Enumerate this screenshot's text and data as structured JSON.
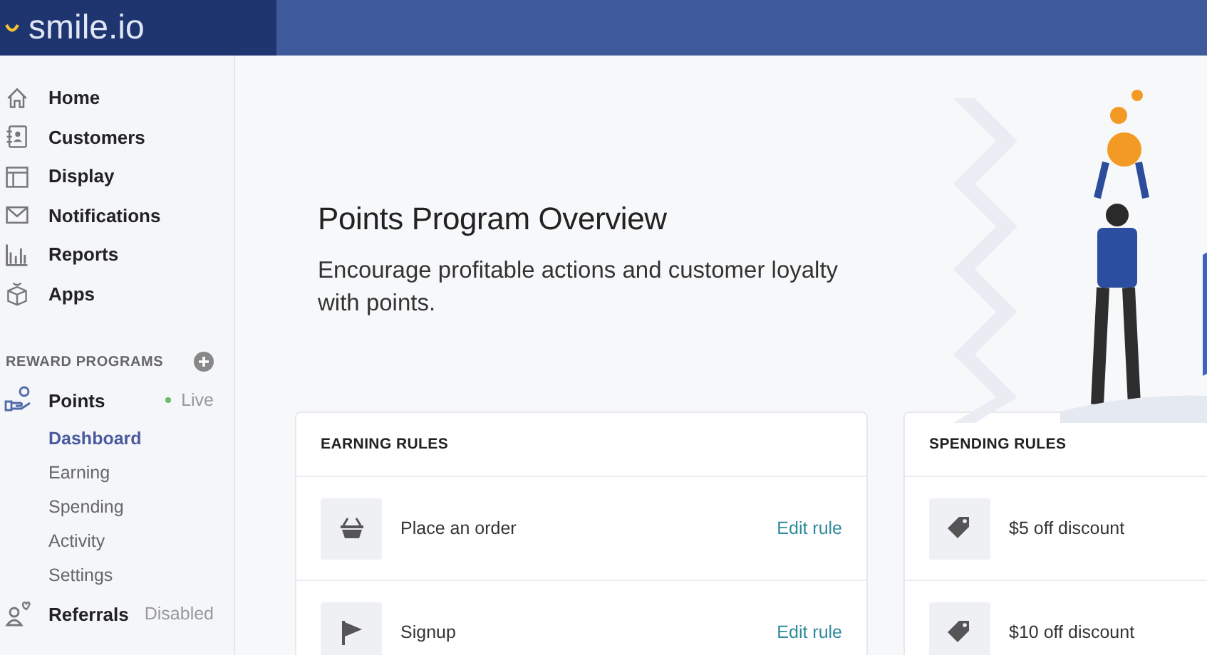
{
  "logo": {
    "text": "smile.io"
  },
  "sidebar": {
    "items": [
      {
        "label": "Home"
      },
      {
        "label": "Customers"
      },
      {
        "label": "Display"
      },
      {
        "label": "Notifications"
      },
      {
        "label": "Reports"
      },
      {
        "label": "Apps"
      }
    ],
    "section_title": "REWARD PROGRAMS",
    "programs": [
      {
        "label": "Points",
        "status": "Live",
        "live": true,
        "children": [
          {
            "label": "Dashboard",
            "selected": true
          },
          {
            "label": "Earning",
            "selected": false
          },
          {
            "label": "Spending",
            "selected": false
          },
          {
            "label": "Activity",
            "selected": false
          },
          {
            "label": "Settings",
            "selected": false
          }
        ]
      },
      {
        "label": "Referrals",
        "status": "Disabled",
        "live": false
      }
    ]
  },
  "hero": {
    "title": "Points Program Overview",
    "subtitle": "Encourage profitable actions and customer loyalty with points."
  },
  "cards": [
    {
      "title": "EARNING RULES",
      "rows": [
        {
          "label": "Place an order",
          "action": "Edit rule"
        },
        {
          "label": "Signup",
          "action": "Edit rule"
        }
      ]
    },
    {
      "title": "SPENDING RULES",
      "rows": [
        {
          "label": "$5 off discount"
        },
        {
          "label": "$10 off discount"
        }
      ]
    }
  ]
}
